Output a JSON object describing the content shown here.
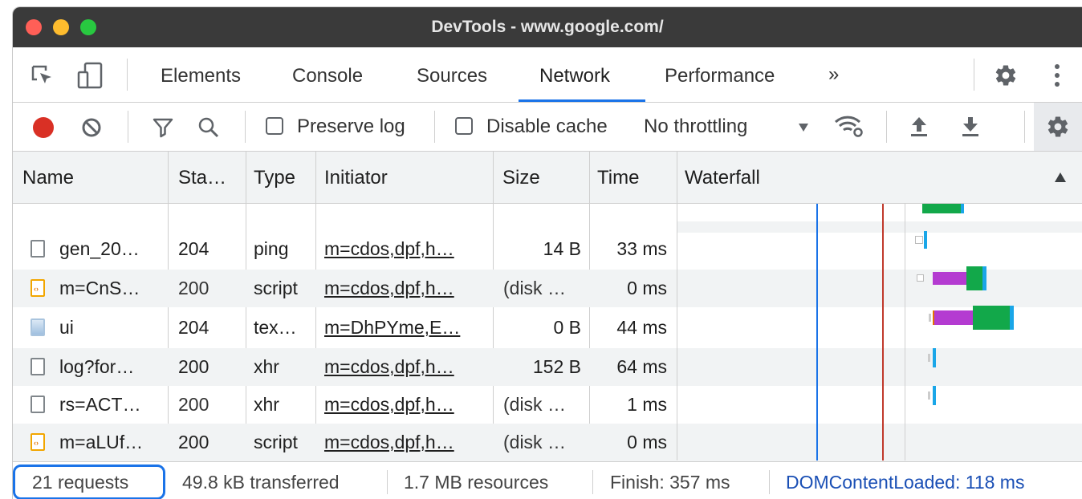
{
  "window": {
    "title": "DevTools - www.google.com/"
  },
  "tabs": [
    {
      "label": "Elements",
      "active": false
    },
    {
      "label": "Console",
      "active": false
    },
    {
      "label": "Sources",
      "active": false
    },
    {
      "label": "Network",
      "active": true
    },
    {
      "label": "Performance",
      "active": false
    },
    {
      "label": "»",
      "active": false
    }
  ],
  "toolbar": {
    "preserve_log_label": "Preserve log",
    "preserve_log_checked": false,
    "disable_cache_label": "Disable cache",
    "disable_cache_checked": false,
    "throttling_value": "No throttling"
  },
  "columns": [
    "Name",
    "Sta…",
    "Type",
    "Initiator",
    "Size",
    "Time",
    "Waterfall"
  ],
  "rows": [
    {
      "name": "gen_20…",
      "status": "204",
      "type": "ping",
      "initiator": "m=cdos,dpf,h…",
      "size": "14 B",
      "time": "33 ms",
      "icon": "document-icon"
    },
    {
      "name": "m=CnS…",
      "status": "200",
      "type": "script",
      "initiator": "m=cdos,dpf,h…",
      "size": "(disk …",
      "time": "0 ms",
      "icon": "script-icon"
    },
    {
      "name": "ui",
      "status": "204",
      "type": "tex…",
      "initiator": "m=DhPYme,E…",
      "size": "0 B",
      "time": "44 ms",
      "icon": "image-icon"
    },
    {
      "name": "log?for…",
      "status": "200",
      "type": "xhr",
      "initiator": "m=cdos,dpf,h…",
      "size": "152 B",
      "time": "64 ms",
      "icon": "document-icon"
    },
    {
      "name": "rs=ACT…",
      "status": "200",
      "type": "xhr",
      "initiator": "m=cdos,dpf,h…",
      "size": "(disk …",
      "time": "1 ms",
      "icon": "document-icon"
    },
    {
      "name": "m=aLUf…",
      "status": "200",
      "type": "script",
      "initiator": "m=cdos,dpf,h…",
      "size": "(disk …",
      "time": "0 ms",
      "icon": "script-icon"
    }
  ],
  "status": {
    "requests": "21 requests",
    "transferred": "49.8 kB transferred",
    "resources": "1.7 MB resources",
    "finish": "Finish: 357 ms",
    "dcl": "DOMContentLoaded: 118 ms"
  },
  "colors": {
    "accent": "#1a73e8",
    "record": "#d93025",
    "waterfall_green": "#12a84a",
    "waterfall_purple": "#b43bd1",
    "waterfall_blue": "#1aa6e8",
    "dcl_line": "#1a73e8",
    "load_line": "#c0392b"
  }
}
